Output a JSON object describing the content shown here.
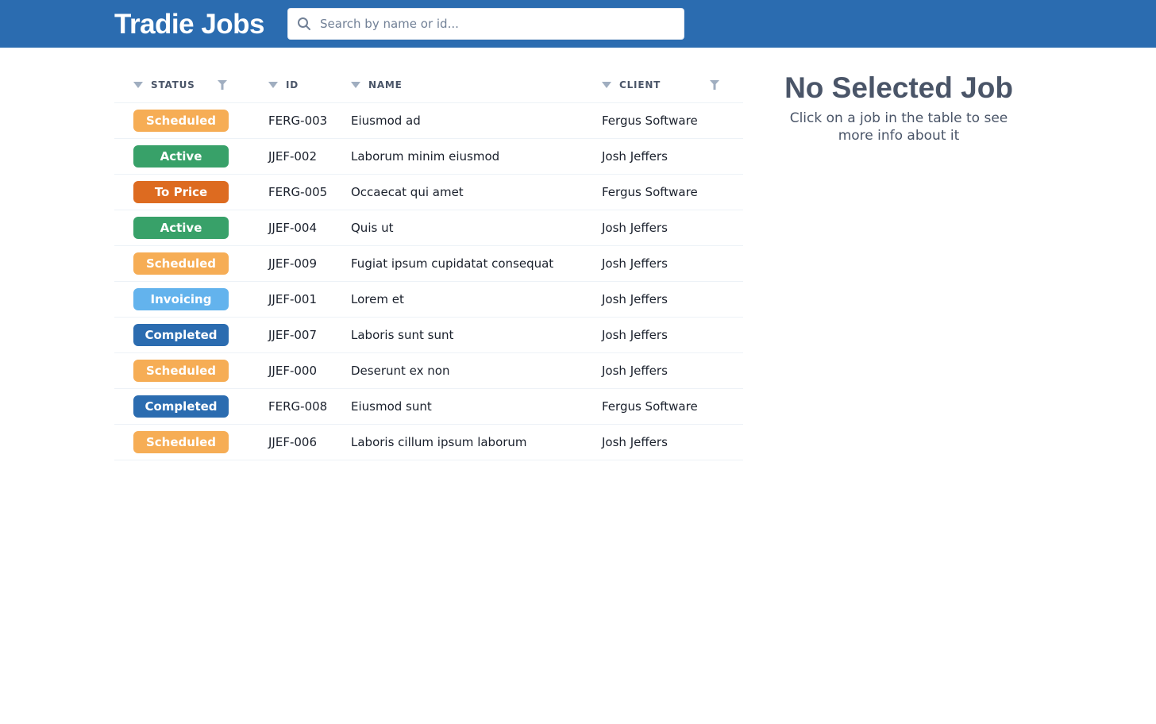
{
  "header": {
    "title": "Tradie Jobs",
    "search": {
      "placeholder": "Search by name or id...",
      "value": "",
      "icon": "search-icon"
    }
  },
  "table": {
    "columns": [
      {
        "label": "STATUS",
        "sortable": true,
        "filterable": true
      },
      {
        "label": "ID",
        "sortable": true,
        "filterable": false
      },
      {
        "label": "NAME",
        "sortable": true,
        "filterable": false
      },
      {
        "label": "CLIENT",
        "sortable": true,
        "filterable": true
      }
    ],
    "rows": [
      {
        "status": "Scheduled",
        "id": "FERG-003",
        "name": "Eiusmod ad",
        "client": "Fergus Software"
      },
      {
        "status": "Active",
        "id": "JJEF-002",
        "name": "Laborum minim eiusmod",
        "client": "Josh Jeffers"
      },
      {
        "status": "To Price",
        "id": "FERG-005",
        "name": "Occaecat qui amet",
        "client": "Fergus Software"
      },
      {
        "status": "Active",
        "id": "JJEF-004",
        "name": "Quis ut",
        "client": "Josh Jeffers"
      },
      {
        "status": "Scheduled",
        "id": "JJEF-009",
        "name": "Fugiat ipsum cupidatat consequat",
        "client": "Josh Jeffers"
      },
      {
        "status": "Invoicing",
        "id": "JJEF-001",
        "name": "Lorem et",
        "client": "Josh Jeffers"
      },
      {
        "status": "Completed",
        "id": "JJEF-007",
        "name": "Laboris sunt sunt",
        "client": "Josh Jeffers"
      },
      {
        "status": "Scheduled",
        "id": "JJEF-000",
        "name": "Deserunt ex non",
        "client": "Josh Jeffers"
      },
      {
        "status": "Completed",
        "id": "FERG-008",
        "name": "Eiusmod sunt",
        "client": "Fergus Software"
      },
      {
        "status": "Scheduled",
        "id": "JJEF-006",
        "name": "Laboris cillum ipsum laborum",
        "client": "Josh Jeffers"
      }
    ]
  },
  "status_colors": {
    "Scheduled": "#f6ad55",
    "Active": "#38a169",
    "To Price": "#dd6b20",
    "Invoicing": "#63b3ed",
    "Completed": "#2b6cb0"
  },
  "detail": {
    "title": "No Selected Job",
    "message": "Click on a job in the table to see more info about it"
  },
  "theme": {
    "header_bg": "#2b6cb0"
  }
}
